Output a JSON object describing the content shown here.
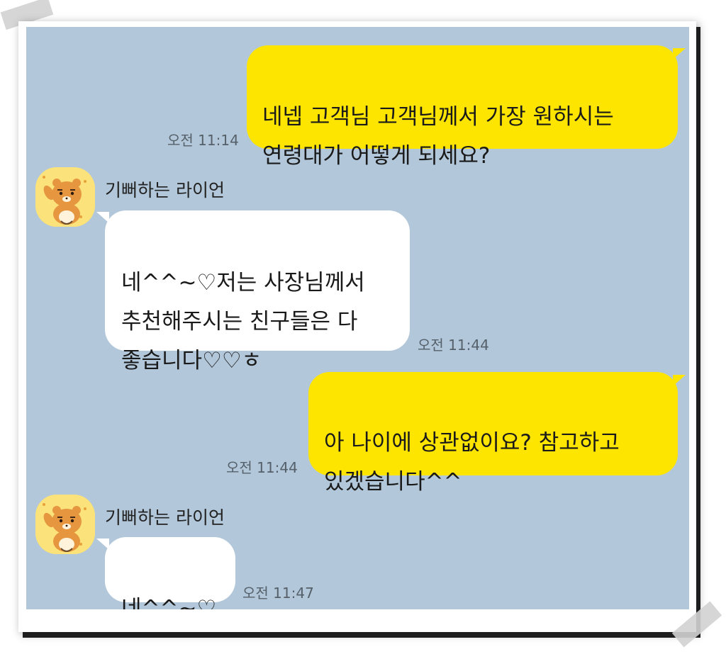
{
  "messages": [
    {
      "side": "mine",
      "text": "네넵 고객님 고객님께서 가장 원하시는\n연령대가 어떻게 되세요?",
      "time": "오전 11:14"
    },
    {
      "side": "theirs",
      "sender": "기뻐하는 라이언",
      "text": "네^^~♡저는 사장님께서\n추천해주시는 친구들은 다\n좋습니다♡♡ㅎ",
      "time": "오전 11:44"
    },
    {
      "side": "mine",
      "text": "아 나이에 상관없이요? 참고하고\n있겠습니다^^",
      "time": "오전 11:44"
    },
    {
      "side": "theirs",
      "sender": "기뻐하는 라이언",
      "text": "네^^~♡",
      "time": "오전 11:47"
    }
  ],
  "colors": {
    "chat_background": "#b2c7d9",
    "my_bubble": "#fee500",
    "their_bubble": "#ffffff"
  },
  "icons": {
    "avatar": "ryan-character-icon"
  }
}
